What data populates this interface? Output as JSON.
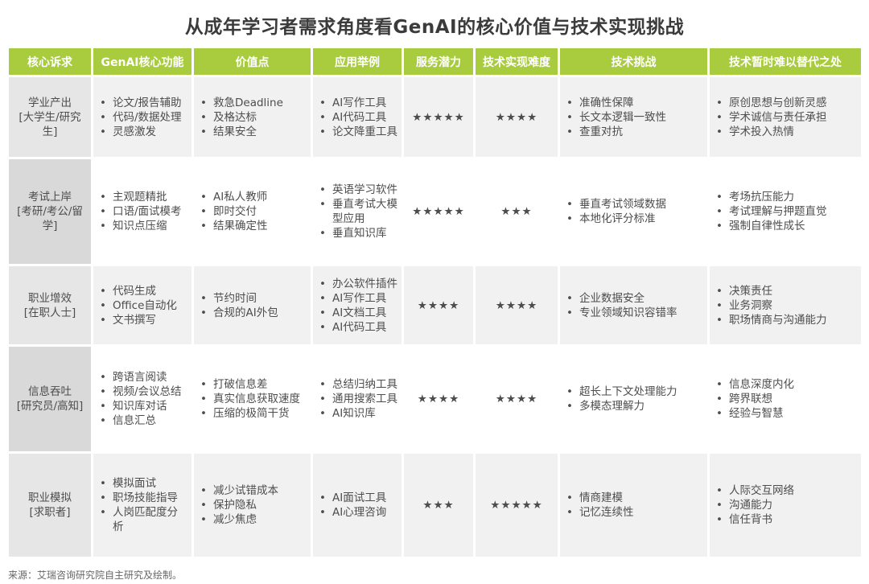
{
  "title": "从成年学习者需求角度看GenAI的核心价值与技术实现挑战",
  "headers": [
    "核心诉求",
    "GenAI核心功能",
    "价值点",
    "应用举例",
    "服务潜力",
    "技术实现难度",
    "技术挑战",
    "技术暂时难以替代之处"
  ],
  "rows": [
    {
      "need": [
        "学业产出",
        "[大学生/研究生]"
      ],
      "functions": [
        "论文/报告辅助",
        "代码/数据处理",
        "灵感激发"
      ],
      "values": [
        "救急Deadline",
        "及格达标",
        "结果安全"
      ],
      "examples": [
        "AI写作工具",
        "AI代码工具",
        "论文降重工具"
      ],
      "potential": "★★★★★",
      "difficulty": "★★★★",
      "challenges": [
        "准确性保障",
        "长文本逻辑一致性",
        "查重对抗"
      ],
      "irreplaceable": [
        "原创思想与创新灵感",
        "学术诚信与责任承担",
        "学术投入热情"
      ]
    },
    {
      "need": [
        "考试上岸",
        "[考研/考公/留学]"
      ],
      "functions": [
        "主观题精批",
        "口语/面试模考",
        "知识点压缩"
      ],
      "values": [
        "AI私人教师",
        "即时交付",
        "结果确定性"
      ],
      "examples": [
        "英语学习软件",
        "垂直考试大模型应用",
        "垂直知识库"
      ],
      "potential": "★★★★★",
      "difficulty": "★★★",
      "challenges": [
        "垂直考试领域数据",
        "本地化评分标准"
      ],
      "irreplaceable": [
        "考场抗压能力",
        "考试理解与押题直觉",
        "强制自律性成长"
      ]
    },
    {
      "need": [
        "职业增效",
        "[在职人士]"
      ],
      "functions": [
        "代码生成",
        "Office自动化",
        "文书撰写"
      ],
      "values": [
        "节约时间",
        "合规的AI外包"
      ],
      "examples": [
        "办公软件插件",
        "AI写作工具",
        "AI文档工具",
        "AI代码工具"
      ],
      "potential": "★★★★",
      "difficulty": "★★★★",
      "challenges": [
        "企业数据安全",
        "专业领域知识容错率"
      ],
      "irreplaceable": [
        "决策责任",
        "业务洞察",
        "职场情商与沟通能力"
      ]
    },
    {
      "need": [
        "信息吞吐",
        "[研究员/高知]"
      ],
      "functions": [
        "跨语言阅读",
        "视频/会议总结",
        "知识库对话",
        "信息汇总"
      ],
      "values": [
        "打破信息差",
        "真实信息获取速度",
        "压缩的极简干货"
      ],
      "examples": [
        "总结归纳工具",
        "通用搜索工具",
        "AI知识库"
      ],
      "potential": "★★★★",
      "difficulty": "★★★★",
      "challenges": [
        "超长上下文处理能力",
        "多模态理解力"
      ],
      "irreplaceable": [
        "信息深度内化",
        "跨界联想",
        "经验与智慧"
      ]
    },
    {
      "need": [
        "职业模拟",
        "[求职者]"
      ],
      "functions": [
        "模拟面试",
        "职场技能指导",
        "人岗匹配度分析"
      ],
      "values": [
        "减少试错成本",
        "保护隐私",
        "减少焦虑"
      ],
      "examples": [
        "AI面试工具",
        "AI心理咨询"
      ],
      "potential": "★★★",
      "difficulty": "★★★★★",
      "challenges": [
        "情商建模",
        "记忆连续性"
      ],
      "irreplaceable": [
        "人际交互网络",
        "沟通能力",
        "信任背书"
      ]
    }
  ],
  "source": "来源：艾瑞咨询研究院自主研究及绘制。"
}
